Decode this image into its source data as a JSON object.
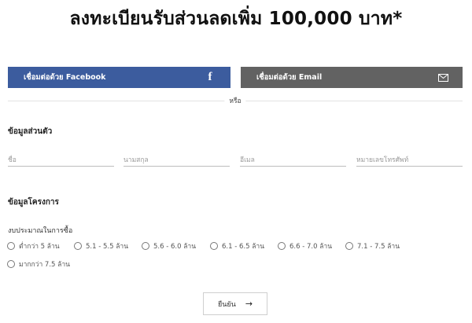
{
  "headline": "ลงทะเบียนรับส่วนลดเพิ่ม 100,000 บาท*",
  "social": {
    "facebook_label": "เชื่อมต่อด้วย Facebook",
    "facebook_icon": "f",
    "email_label": "เชื่อมต่อด้วย Email",
    "facebook_color": "#3c5c9e",
    "email_color": "#626262"
  },
  "divider_text": "หรือ",
  "personal": {
    "title": "ข้อมูลส่วนตัว",
    "first_name_placeholder": "ชื่อ",
    "last_name_placeholder": "นามสกุล",
    "email_placeholder": "อีเมล",
    "phone_placeholder": "หมายเลขโทรศัพท์"
  },
  "project": {
    "title": "ข้อมูลโครงการ",
    "budget_label": "งบประมาณในการซื้อ",
    "options": [
      "ต่ำกว่า 5 ล้าน",
      "5.1 - 5.5 ล้าน",
      "5.6 - 6.0 ล้าน",
      "6.1 - 6.5 ล้าน",
      "6.6 - 7.0 ล้าน",
      "7.1 - 7.5 ล้าน",
      "มากกว่า 7.5 ล้าน"
    ]
  },
  "submit": {
    "label": "ยืนยัน",
    "icon": "→"
  }
}
